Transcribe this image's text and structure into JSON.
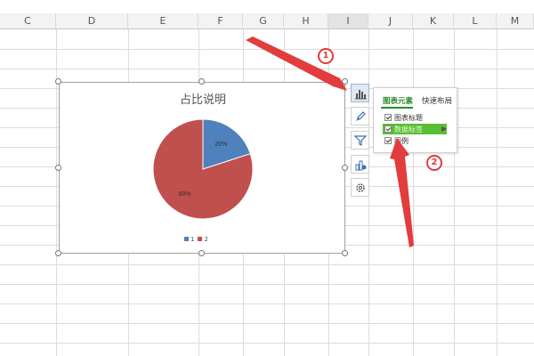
{
  "columns": [
    "C",
    "D",
    "E",
    "F",
    "G",
    "H",
    "I",
    "J",
    "K",
    "L",
    "M"
  ],
  "active_column": "I",
  "chart": {
    "title": "占比说明",
    "slice_labels": [
      "20%",
      "80%"
    ],
    "legend": [
      "1",
      "2"
    ]
  },
  "chart_data": {
    "type": "pie",
    "title": "占比说明",
    "categories": [
      "1",
      "2"
    ],
    "values": [
      20,
      80
    ],
    "labels": [
      "20%",
      "80%"
    ],
    "colors": [
      "#4f81bd",
      "#c0504d"
    ],
    "legend_position": "bottom"
  },
  "side_buttons": [
    {
      "icon": "chart-elements-icon",
      "active": true
    },
    {
      "icon": "chart-style-brush-icon",
      "active": false
    },
    {
      "icon": "chart-filter-icon",
      "active": false
    },
    {
      "icon": "chart-settings-icon",
      "active": false
    },
    {
      "icon": "gear-icon",
      "active": false
    }
  ],
  "popup": {
    "tabs": [
      "图表元素",
      "快速布局"
    ],
    "options": [
      "图表标题",
      "数据标签",
      "图例"
    ],
    "checked": [
      true,
      true,
      true
    ],
    "highlighted_option": "数据标签"
  },
  "annotations": {
    "badge1": "1",
    "badge2": "2",
    "color": "#e23c3c"
  }
}
